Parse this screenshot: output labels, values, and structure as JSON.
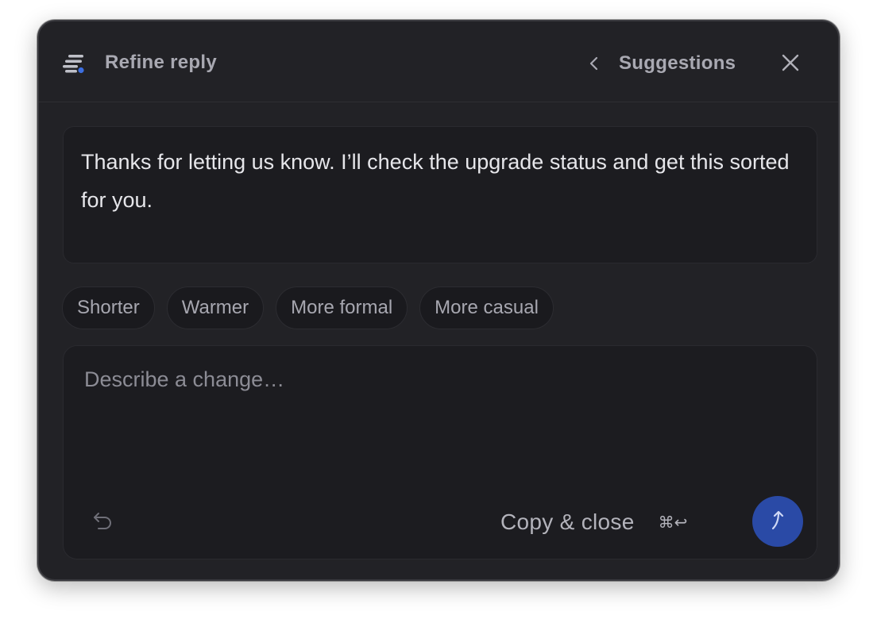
{
  "header": {
    "title": "Refine reply",
    "suggestions_label": "Suggestions",
    "icons": {
      "logo": "stacked-lines-logo-icon",
      "back": "chevron-left-icon",
      "close": "close-icon"
    }
  },
  "reply": {
    "text": "Thanks for letting us know. I’ll check the upgrade status and get this sorted for you."
  },
  "chips": [
    {
      "label": "Shorter"
    },
    {
      "label": "Warmer"
    },
    {
      "label": "More formal"
    },
    {
      "label": "More casual"
    }
  ],
  "composer": {
    "placeholder": "Describe a change…",
    "value": "",
    "copy_close_label": "Copy & close",
    "shortcut": "⌘↩",
    "icons": {
      "undo": "undo-arrow-icon",
      "send": "send-arrow-icon"
    }
  },
  "colors": {
    "panel_bg": "#222226",
    "field_bg": "#1c1c20",
    "accent": "#2a4aa6",
    "logo_dot": "#3d6fe0"
  }
}
